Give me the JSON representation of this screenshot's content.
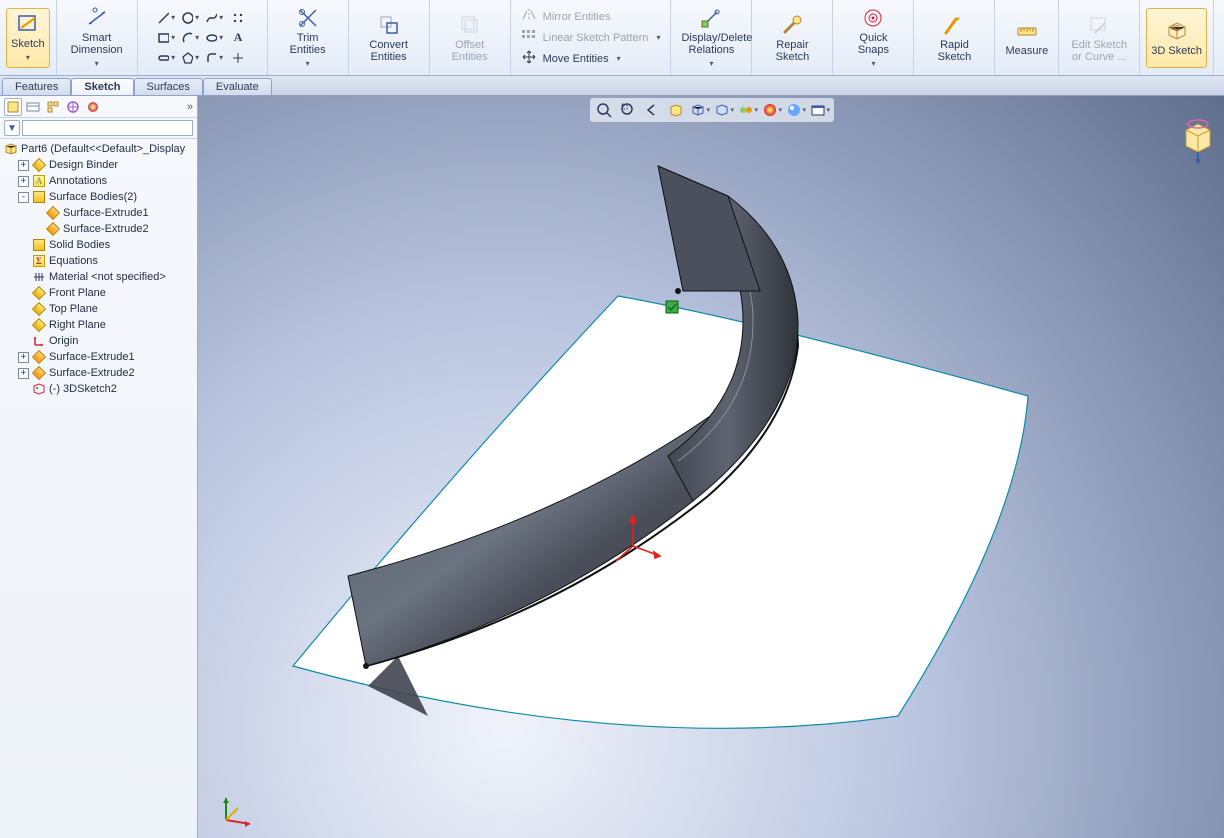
{
  "ribbon": {
    "sketch": "Sketch",
    "smart_dimension": "Smart Dimension",
    "trim": "Trim Entities",
    "convert": "Convert Entities",
    "offset": "Offset Entities",
    "mirror": "Mirror Entities",
    "linear_pattern": "Linear Sketch Pattern",
    "move": "Move Entities",
    "display_relations": "Display/Delete Relations",
    "repair": "Repair Sketch",
    "quick_snaps": "Quick Snaps",
    "rapid": "Rapid Sketch",
    "measure": "Measure",
    "edit_curve": "Edit Sketch or Curve ...",
    "sketch3d": "3D Sketch"
  },
  "tabs": {
    "features": "Features",
    "sketch": "Sketch",
    "surfaces": "Surfaces",
    "evaluate": "Evaluate"
  },
  "tree": {
    "root": "Part6  (Default<<Default>_Display",
    "design_binder": "Design Binder",
    "annotations": "Annotations",
    "surface_bodies": "Surface Bodies(2)",
    "surf_ext1": "Surface-Extrude1",
    "surf_ext2": "Surface-Extrude2",
    "solid_bodies": "Solid Bodies",
    "equations": "Equations",
    "material": "Material <not specified>",
    "front_plane": "Front Plane",
    "top_plane": "Top Plane",
    "right_plane": "Right Plane",
    "origin": "Origin",
    "feat_ext1": "Surface-Extrude1",
    "feat_ext2": "Surface-Extrude2",
    "sketch3d": "(-) 3DSketch2"
  },
  "filter_placeholder": ""
}
